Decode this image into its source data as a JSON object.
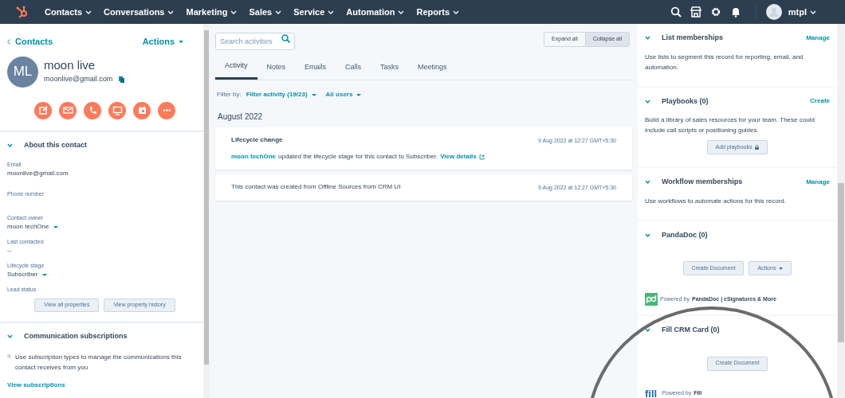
{
  "nav": {
    "items": [
      "Contacts",
      "Conversations",
      "Marketing",
      "Sales",
      "Service",
      "Automation",
      "Reports"
    ],
    "user": "mtpl"
  },
  "contact": {
    "back": "Contacts",
    "actions": "Actions",
    "initials": "ML",
    "name": "moon live",
    "email": "moonlive@gmail.com"
  },
  "about": {
    "title": "About this contact",
    "properties": [
      {
        "label": "Email",
        "value": "moonlive@gmail.com",
        "kind": "text"
      },
      {
        "label": "Phone number",
        "kind": "text"
      },
      {
        "label": "Contact owner",
        "value": "moon techOne",
        "kind": "select"
      },
      {
        "label": "Last contacted",
        "value": "--",
        "kind": "text"
      },
      {
        "label": "Lifecycle stage",
        "value": "Subscriber",
        "kind": "select"
      },
      {
        "label": "Lead status",
        "kind": "text"
      }
    ],
    "buttons": [
      "View all properties",
      "View property history"
    ]
  },
  "subscriptions": {
    "title": "Communication subscriptions",
    "text": "Use subscription types to manage the communications this contact receives from you",
    "link": "View subscriptions"
  },
  "activity": {
    "search": {
      "placeholder": "Search activities"
    },
    "toggles": [
      {
        "label": "Expand all",
        "selected": false
      },
      {
        "label": "Collapse all",
        "selected": true
      }
    ],
    "tabs": [
      {
        "label": "Activity",
        "selected": true
      },
      {
        "label": "Notes",
        "selected": false
      },
      {
        "label": "Emails",
        "selected": false
      },
      {
        "label": "Calls",
        "selected": false
      },
      {
        "label": "Tasks",
        "selected": false
      },
      {
        "label": "Meetings",
        "selected": false
      }
    ],
    "filter_label": "Filter by:",
    "filters": [
      "Filter activity (19/23)",
      "All users"
    ],
    "month": "August 2022",
    "events": [
      {
        "title": "Lifecycle change",
        "time": "9 Aug 2022 at 12:27 GMT+5:30",
        "actor": "moon techOne",
        "text": "updated the lifecycle stage for this contact to Subscriber.",
        "link": "View details"
      },
      {
        "time": "9 Aug 2022 at 12:27 GMT+5:30",
        "text": "This contact was created from Offline Sources from CRM UI"
      }
    ]
  },
  "cards": [
    {
      "title": "List memberships",
      "action": "Manage",
      "text": "Use lists to segment this record for reporting, email, and automation."
    },
    {
      "title": "Playbooks (0)",
      "action": "Create",
      "text": "Build a library of sales resources for your team. These could include call scripts or positioning guides.",
      "buttons": [
        {
          "label": "Add playbooks",
          "kind": "locked"
        }
      ]
    },
    {
      "title": "Workflow memberships",
      "action": "Manage",
      "text": "Use workflows to automate actions for this record."
    },
    {
      "title": "PandaDoc (0)",
      "buttons": [
        {
          "label": "Create Document",
          "kind": "plain"
        },
        {
          "label": "Actions",
          "kind": "menu"
        }
      ],
      "footer": {
        "kind": "pandadoc",
        "prefix": "Powered by",
        "brand": "PandaDoc | eSignatures & More"
      }
    },
    {
      "title": "Fill CRM Card (0)",
      "buttons": [
        {
          "label": "Create Document",
          "kind": "plain"
        }
      ],
      "footer": {
        "kind": "fill",
        "logo": "fill",
        "prefix": "Powered by",
        "brand": "Fill"
      }
    }
  ]
}
